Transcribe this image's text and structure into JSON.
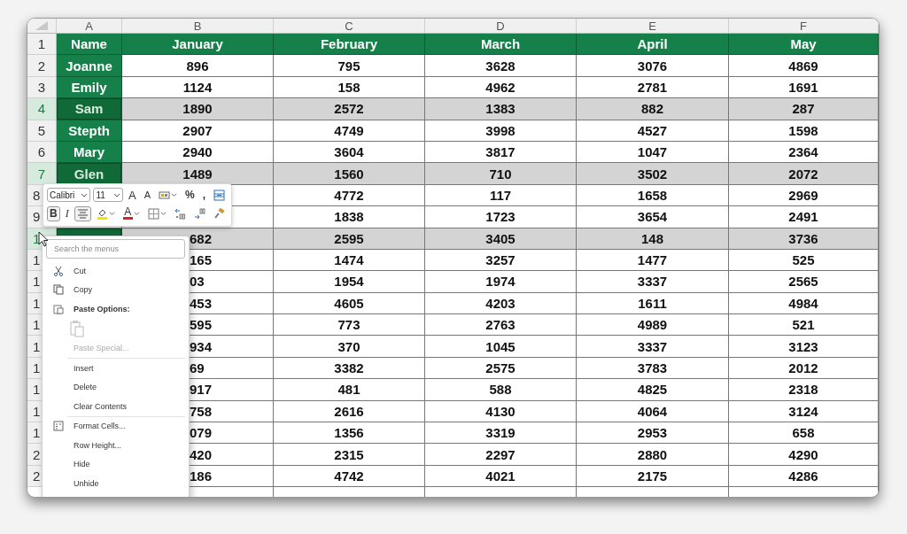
{
  "columns": [
    "A",
    "B",
    "C",
    "D",
    "E",
    "F"
  ],
  "header_row": {
    "label": "1",
    "cells": [
      "Name",
      "January",
      "February",
      "March",
      "April",
      "May"
    ]
  },
  "rows": [
    {
      "kind": "full",
      "label": "2",
      "selected": false,
      "name": "Joanne",
      "cells": [
        "896",
        "795",
        "3628",
        "3076",
        "4869"
      ]
    },
    {
      "kind": "full",
      "label": "3",
      "selected": false,
      "name": "Emily",
      "cells": [
        "1124",
        "158",
        "4962",
        "2781",
        "1691"
      ]
    },
    {
      "kind": "full",
      "label": "4",
      "selected": true,
      "name": "Sam",
      "cells": [
        "1890",
        "2572",
        "1383",
        "882",
        "287"
      ]
    },
    {
      "kind": "full",
      "label": "5",
      "selected": false,
      "name": "Stepth",
      "cells": [
        "2907",
        "4749",
        "3998",
        "4527",
        "1598"
      ]
    },
    {
      "kind": "full",
      "label": "6",
      "selected": false,
      "name": "Mary",
      "cells": [
        "2940",
        "3604",
        "3817",
        "1047",
        "2364"
      ]
    },
    {
      "kind": "full",
      "label": "7",
      "selected": true,
      "name": "Glen",
      "cells": [
        "1489",
        "1560",
        "710",
        "3502",
        "2072"
      ]
    },
    {
      "kind": "covered",
      "label": "8",
      "selected": false,
      "cells": [
        "4772",
        "117",
        "1658",
        "2969"
      ]
    },
    {
      "kind": "covered",
      "label": "9",
      "selected": false,
      "cells": [
        "1838",
        "1723",
        "3654",
        "2491"
      ]
    },
    {
      "kind": "covered",
      "label": "1",
      "selected": true,
      "column_b": "682",
      "cells": [
        "2595",
        "3405",
        "148",
        "3736"
      ]
    },
    {
      "kind": "covered",
      "label": "1",
      "selected": false,
      "column_b": "165",
      "cells": [
        "1474",
        "3257",
        "1477",
        "525"
      ]
    },
    {
      "kind": "covered",
      "label": "1",
      "selected": false,
      "column_b": "03",
      "cells": [
        "1954",
        "1974",
        "3337",
        "2565"
      ]
    },
    {
      "kind": "covered",
      "label": "1",
      "selected": false,
      "column_b": "453",
      "cells": [
        "4605",
        "4203",
        "1611",
        "4984"
      ]
    },
    {
      "kind": "covered",
      "label": "1",
      "selected": false,
      "column_b": "595",
      "cells": [
        "773",
        "2763",
        "4989",
        "521"
      ]
    },
    {
      "kind": "covered",
      "label": "1",
      "selected": false,
      "column_b": "934",
      "cells": [
        "370",
        "1045",
        "3337",
        "3123"
      ]
    },
    {
      "kind": "covered",
      "label": "1",
      "selected": false,
      "column_b": "69",
      "cells": [
        "3382",
        "2575",
        "3783",
        "2012"
      ]
    },
    {
      "kind": "covered",
      "label": "1",
      "selected": false,
      "column_b": "917",
      "cells": [
        "481",
        "588",
        "4825",
        "2318"
      ]
    },
    {
      "kind": "covered",
      "label": "1",
      "selected": false,
      "column_b": "758",
      "cells": [
        "2616",
        "4130",
        "4064",
        "3124"
      ]
    },
    {
      "kind": "covered",
      "label": "1",
      "selected": false,
      "column_b": "079",
      "cells": [
        "1356",
        "3319",
        "2953",
        "658"
      ]
    },
    {
      "kind": "covered",
      "label": "2",
      "selected": false,
      "column_b": "420",
      "cells": [
        "2315",
        "2297",
        "2880",
        "4290"
      ]
    },
    {
      "kind": "covered",
      "label": "2",
      "selected": false,
      "column_b": "186",
      "cells": [
        "4742",
        "4021",
        "2175",
        "4286"
      ]
    }
  ],
  "mini_toolbar": {
    "font": "Calibri",
    "size": "11",
    "row_1": [
      {
        "kind": "grow-font",
        "label": "A"
      },
      {
        "kind": "shrink-font",
        "label": "A"
      },
      {
        "kind": "number-format",
        "dropdown": true
      },
      {
        "kind": "percent",
        "label": "%"
      },
      {
        "kind": "comma",
        "label": ","
      },
      {
        "kind": "merge"
      }
    ],
    "row_2": [
      {
        "kind": "bold",
        "label": "B",
        "on": true
      },
      {
        "kind": "italic",
        "label": "I",
        "on": false
      },
      {
        "kind": "align-center",
        "on": true
      },
      {
        "kind": "fill-color",
        "dropdown": true
      },
      {
        "kind": "font-color",
        "label": "A",
        "dropdown": true
      },
      {
        "kind": "borders",
        "dropdown": true
      },
      {
        "kind": "increase-decimal"
      },
      {
        "kind": "decrease-decimal"
      },
      {
        "kind": "format-painter"
      }
    ]
  },
  "context_menu": {
    "search": {
      "placeholder": "Search the menus"
    },
    "items": [
      {
        "kind": "cut",
        "label": "Cut",
        "disabled": false
      },
      {
        "kind": "copy",
        "label": "Copy",
        "disabled": false
      },
      {
        "kind": "paste-header",
        "label": "Paste Options:"
      },
      {
        "kind": "paste-option",
        "disabled": true
      },
      {
        "kind": "command",
        "label": "Paste Special...",
        "disabled": true
      },
      {
        "kind": "separator"
      },
      {
        "kind": "command",
        "label": "Insert",
        "disabled": false
      },
      {
        "kind": "command",
        "label": "Delete",
        "disabled": false
      },
      {
        "kind": "command",
        "label": "Clear Contents",
        "disabled": false
      },
      {
        "kind": "separator"
      },
      {
        "kind": "format",
        "label": "Format Cells...",
        "disabled": false
      },
      {
        "kind": "command",
        "label": "Row Height...",
        "disabled": false
      },
      {
        "kind": "command",
        "label": "Hide",
        "disabled": false
      },
      {
        "kind": "command",
        "label": "Unhide",
        "disabled": false
      }
    ]
  }
}
